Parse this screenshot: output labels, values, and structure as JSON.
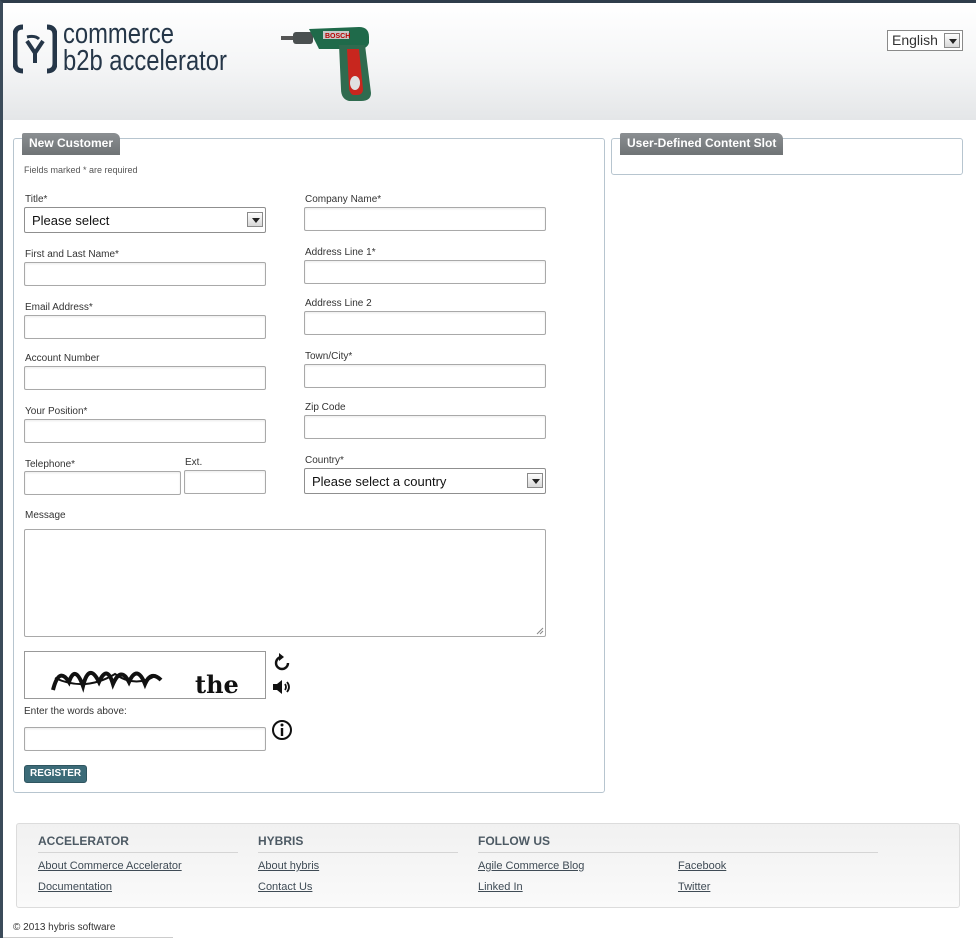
{
  "header": {
    "logo_line1": "commerce",
    "logo_line2": "b2b accelerator",
    "language": "English"
  },
  "form": {
    "panel_title": "New Customer",
    "required_note": "Fields marked * are required",
    "title_label": "Title*",
    "title_value": "Please select",
    "name_label": "First and Last Name*",
    "email_label": "Email Address*",
    "account_label": "Account Number",
    "position_label": "Your Position*",
    "telephone_label": "Telephone*",
    "ext_label": "Ext.",
    "company_label": "Company Name*",
    "address1_label": "Address Line 1*",
    "address2_label": "Address Line 2",
    "town_label": "Town/City*",
    "zip_label": "Zip Code",
    "country_label": "Country*",
    "country_value": "Please select a country",
    "message_label": "Message",
    "captcha_prompt": "Enter the words above:",
    "captcha_word1": "snaghn",
    "captcha_word2": "the",
    "register_label": "REGISTER"
  },
  "side_panel": {
    "title": "User-Defined Content Slot"
  },
  "footer": {
    "col1_title": "ACCELERATOR",
    "col1_links": [
      "About Commerce Accelerator",
      "Documentation"
    ],
    "col2_title": "HYBRIS",
    "col2_links": [
      "About hybris",
      "Contact Us"
    ],
    "col3_title": "FOLLOW US",
    "col3_links": [
      "Agile Commerce Blog",
      "Linked In"
    ],
    "col4_links": [
      "Facebook",
      "Twitter"
    ],
    "copyright": "© 2013 hybris software"
  },
  "colors": {
    "brand": "#253648",
    "tab": "#7a7e80",
    "button": "#3c6b78"
  }
}
